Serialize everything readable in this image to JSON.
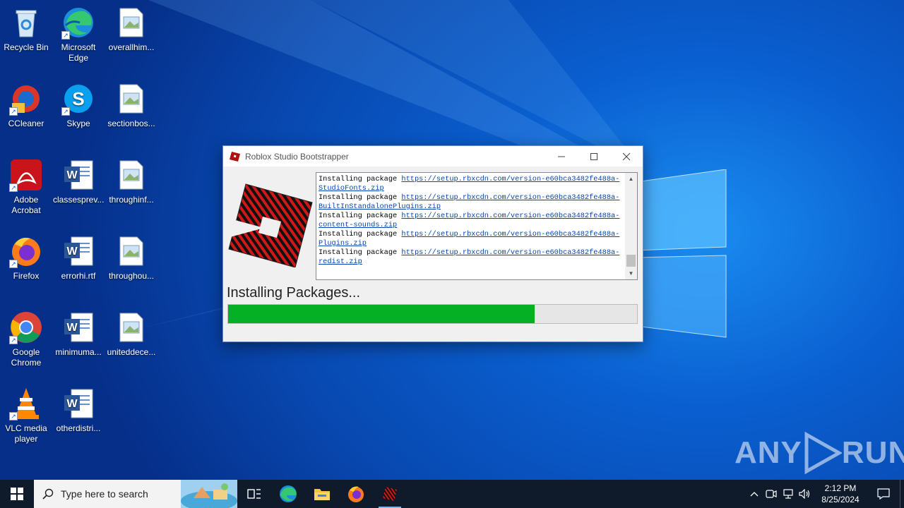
{
  "desktop": {
    "icons": [
      {
        "label": "Recycle Bin",
        "icon": "recycle-bin-icon"
      },
      {
        "label": "Microsoft Edge",
        "icon": "edge-icon"
      },
      {
        "label": "overallhim...",
        "icon": "image-file-icon"
      },
      {
        "label": "CCleaner",
        "icon": "ccleaner-icon"
      },
      {
        "label": "Skype",
        "icon": "skype-icon"
      },
      {
        "label": "sectionbos...",
        "icon": "image-file-icon"
      },
      {
        "label": "Adobe Acrobat",
        "icon": "acrobat-icon"
      },
      {
        "label": "classesprev...",
        "icon": "word-doc-icon"
      },
      {
        "label": "throughinf...",
        "icon": "image-file-icon"
      },
      {
        "label": "Firefox",
        "icon": "firefox-icon"
      },
      {
        "label": "errorhi.rtf",
        "icon": "word-doc-icon"
      },
      {
        "label": "throughou...",
        "icon": "image-file-icon"
      },
      {
        "label": "Google Chrome",
        "icon": "chrome-icon"
      },
      {
        "label": "minimuma...",
        "icon": "word-doc-icon"
      },
      {
        "label": "uniteddece...",
        "icon": "image-file-icon"
      },
      {
        "label": "VLC media player",
        "icon": "vlc-icon"
      },
      {
        "label": "otherdistri...",
        "icon": "word-doc-icon"
      }
    ]
  },
  "window": {
    "title": "Roblox Studio Bootstrapper",
    "log": [
      {
        "prefix": "Installing package ",
        "link1": "https://setup.rbxcdn.com/version-e60bca3482fe488a-",
        "link2": "StudioFonts.zip"
      },
      {
        "prefix": "Installing package ",
        "link1": "https://setup.rbxcdn.com/version-e60bca3482fe488a-",
        "link2": "BuiltInStandalonePlugins.zip"
      },
      {
        "prefix": "Installing package ",
        "link1": "https://setup.rbxcdn.com/version-e60bca3482fe488a-",
        "link2": "content-sounds.zip"
      },
      {
        "prefix": "Installing package ",
        "link1": "https://setup.rbxcdn.com/version-e60bca3482fe488a-",
        "link2": "Plugins.zip"
      },
      {
        "prefix": "Installing package ",
        "link1": "https://setup.rbxcdn.com/version-e60bca3482fe488a-",
        "link2": "redist.zip"
      }
    ],
    "status": "Installing Packages...",
    "progress_percent": 75,
    "accent_color": "#06b025"
  },
  "taskbar": {
    "search_placeholder": "Type here to search",
    "apps": [
      "task-view-icon",
      "edge-icon",
      "file-explorer-icon",
      "firefox-icon",
      "roblox-icon"
    ],
    "time": "2:12 PM",
    "date": "8/25/2024"
  },
  "watermark": {
    "left": "ANY",
    "right": "RUN"
  }
}
